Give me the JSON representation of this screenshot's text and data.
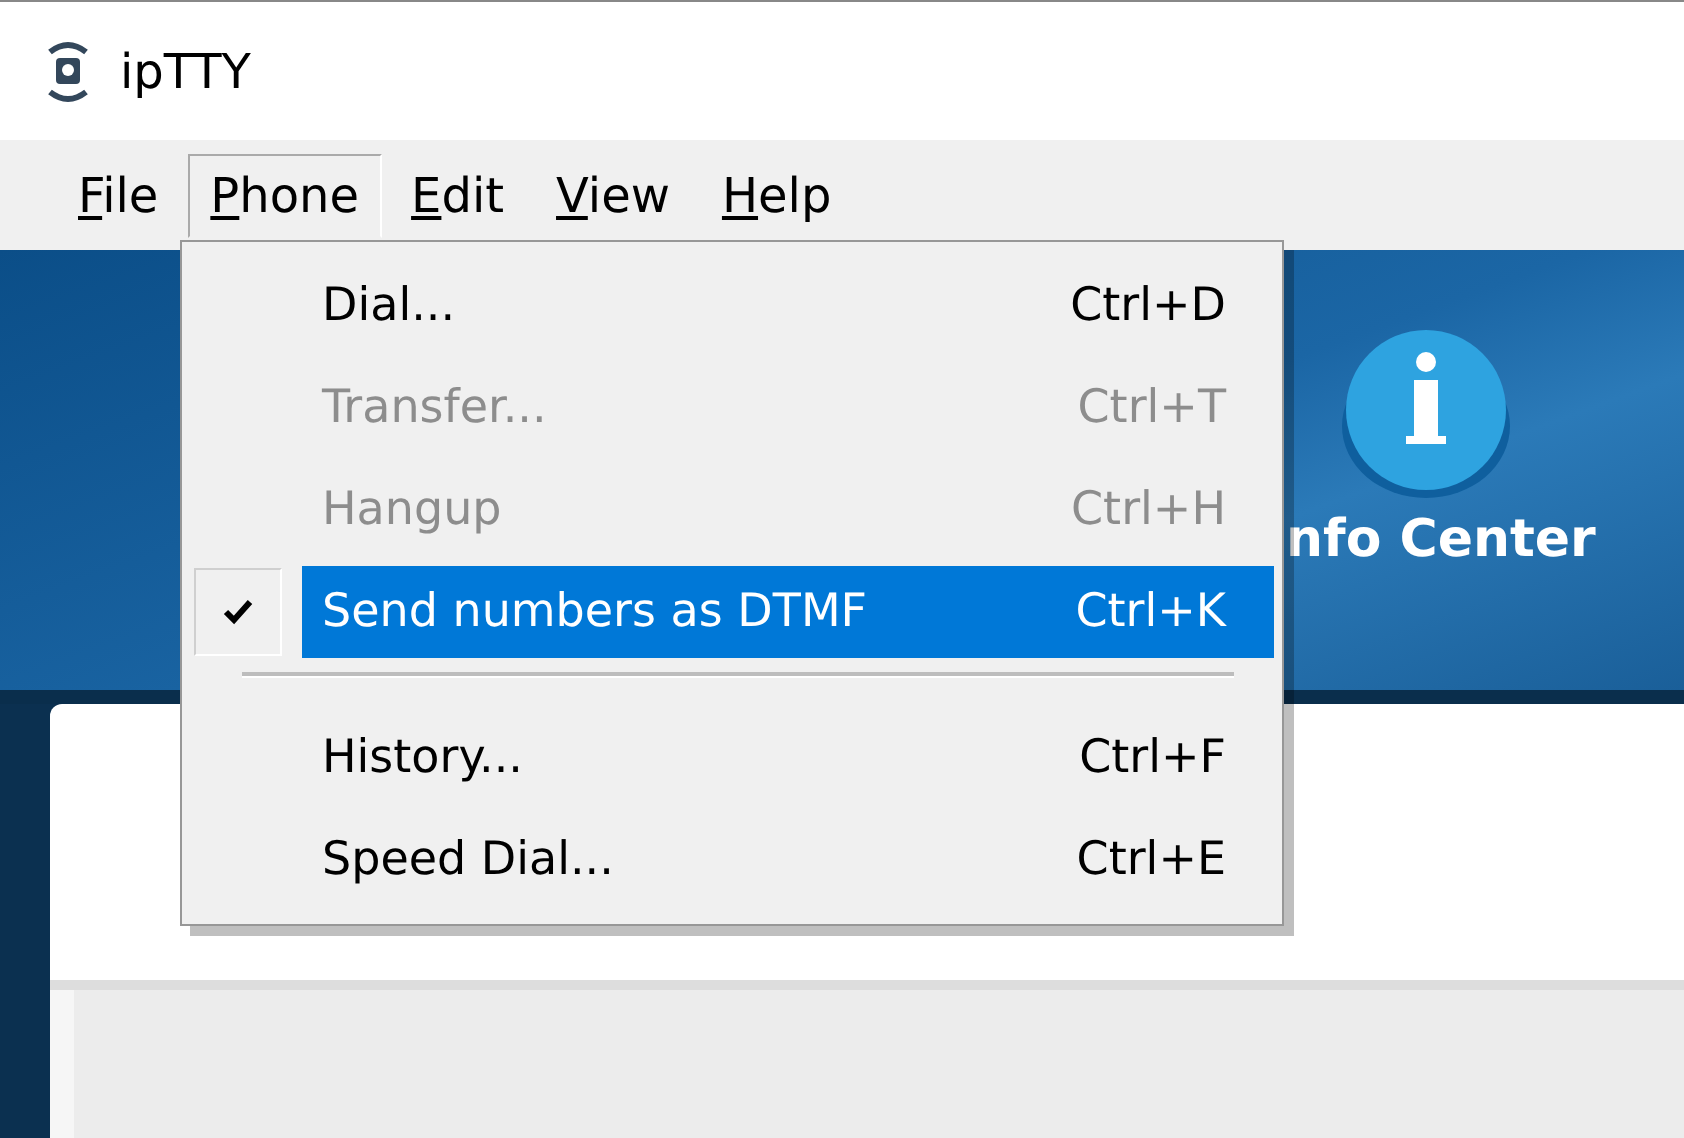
{
  "window": {
    "title": "ipTTY"
  },
  "menubar": [
    {
      "label": "File",
      "selected": false
    },
    {
      "label": "Phone",
      "selected": true
    },
    {
      "label": "Edit",
      "selected": false
    },
    {
      "label": "View",
      "selected": false
    },
    {
      "label": "Help",
      "selected": false
    }
  ],
  "banner": {
    "label": "nfo Center"
  },
  "menu": [
    {
      "kind": "item",
      "label": "Dial...",
      "shortcut": "Ctrl+D",
      "disabled": false,
      "checked": false,
      "selected": false
    },
    {
      "kind": "item",
      "label": "Transfer...",
      "shortcut": "Ctrl+T",
      "disabled": true,
      "checked": false,
      "selected": false
    },
    {
      "kind": "item",
      "label": "Hangup",
      "shortcut": "Ctrl+H",
      "disabled": true,
      "checked": false,
      "selected": false
    },
    {
      "kind": "item",
      "label": "Send numbers as DTMF",
      "shortcut": "Ctrl+K",
      "disabled": false,
      "checked": true,
      "selected": true
    },
    {
      "kind": "separator"
    },
    {
      "kind": "item",
      "label": "History...",
      "shortcut": "Ctrl+F",
      "disabled": false,
      "checked": false,
      "selected": false
    },
    {
      "kind": "item",
      "label": "Speed Dial...",
      "shortcut": "Ctrl+E",
      "disabled": false,
      "checked": false,
      "selected": false
    }
  ]
}
